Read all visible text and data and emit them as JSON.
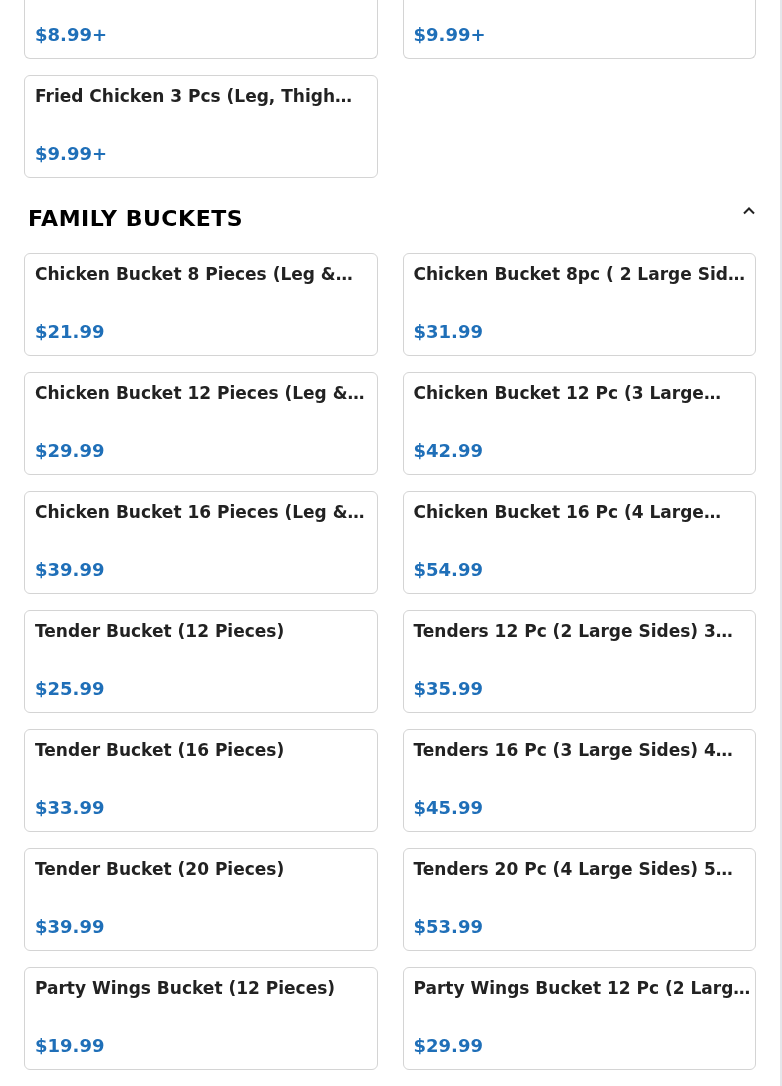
{
  "top_items": [
    {
      "price": "$8.99+"
    },
    {
      "price": "$9.99+"
    },
    {
      "name": "Fried Chicken 3 Pcs (Leg, Thigh…",
      "price": "$9.99+"
    }
  ],
  "sections": [
    {
      "title": "FAMILY BUCKETS",
      "expanded": true,
      "items": [
        {
          "name": "Chicken Bucket 8 Pieces (Leg &…",
          "price": "$21.99"
        },
        {
          "name": "Chicken Bucket 8pc ( 2 Large Sid…",
          "price": "$31.99"
        },
        {
          "name": "Chicken Bucket 12 Pieces (Leg &…",
          "price": "$29.99"
        },
        {
          "name": "Chicken Bucket 12 Pc (3 Large…",
          "price": "$42.99"
        },
        {
          "name": "Chicken Bucket 16 Pieces (Leg &…",
          "price": "$39.99"
        },
        {
          "name": "Chicken Bucket 16 Pc (4 Large…",
          "price": "$54.99"
        },
        {
          "name": "Tender Bucket (12 Pieces)",
          "price": "$25.99"
        },
        {
          "name": "Tenders 12 Pc (2 Large Sides) 3…",
          "price": "$35.99"
        },
        {
          "name": "Tender Bucket (16 Pieces)",
          "price": "$33.99"
        },
        {
          "name": "Tenders 16 Pc (3 Large Sides) 4…",
          "price": "$45.99"
        },
        {
          "name": "Tender Bucket (20 Pieces)",
          "price": "$39.99"
        },
        {
          "name": "Tenders 20 Pc (4 Large Sides) 5…",
          "price": "$53.99"
        },
        {
          "name": "Party Wings Bucket (12 Pieces)",
          "price": "$19.99"
        },
        {
          "name": "Party Wings Bucket 12 Pc (2 Larg…",
          "price": "$29.99"
        }
      ]
    }
  ]
}
